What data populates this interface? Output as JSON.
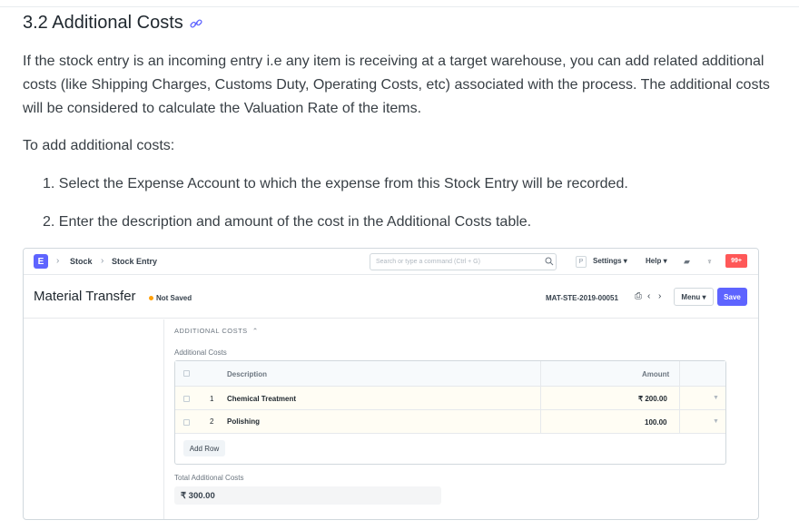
{
  "heading": {
    "title": "3.2 Additional Costs",
    "link_icon": "link-icon"
  },
  "paragraph_intro": "If the stock entry is an incoming entry i.e any item is receiving at a target warehouse, you can add related additional costs (like Shipping Charges, Customs Duty, Operating Costs, etc) associated with the process. The additional costs will be considered to calculate the Valuation Rate of the items.",
  "paragraph_to_add": "To add additional costs:",
  "steps": [
    "1. Select the Expense Account to which the expense from this Stock Entry will be recorded.",
    "2. Enter the description and amount of the cost in the Additional Costs table."
  ],
  "screenshot": {
    "navbar": {
      "logo": "E",
      "breadcrumbs": [
        "Stock",
        "Stock Entry"
      ],
      "search_placeholder": "Search or type a command (Ctrl + G)",
      "user_badge": "P",
      "settings": "Settings",
      "help": "Help",
      "notifications": "99+"
    },
    "header": {
      "title": "Material Transfer",
      "status": "Not Saved",
      "doc_id": "MAT-STE-2019-00051",
      "menu": "Menu",
      "save": "Save"
    },
    "section": {
      "heading": "ADDITIONAL COSTS",
      "field_label": "Additional Costs",
      "columns": {
        "description": "Description",
        "amount": "Amount"
      },
      "rows": [
        {
          "idx": "1",
          "description": "Chemical Treatment",
          "amount": "₹ 200.00"
        },
        {
          "idx": "2",
          "description": "Polishing",
          "amount": "100.00"
        }
      ],
      "add_row": "Add Row",
      "total_label": "Total Additional Costs",
      "total_value": "₹ 300.00"
    },
    "colors": {
      "primary": "#5e64ff",
      "danger": "#ff5858",
      "status_dot": "#ffa00a"
    }
  }
}
